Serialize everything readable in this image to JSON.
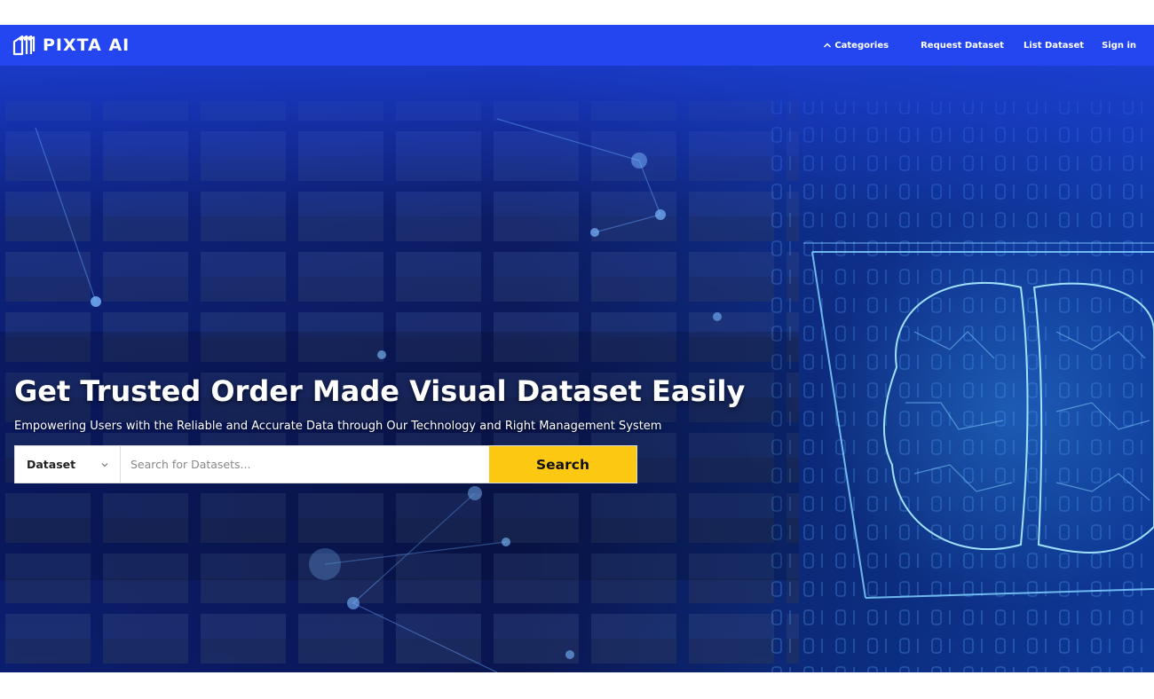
{
  "header": {
    "brand": "PIXTA AI",
    "nav": {
      "categories": "Categories",
      "request_dataset": "Request Dataset",
      "list_dataset": "List Dataset",
      "sign_in": "Sign in"
    },
    "colors": {
      "bar": "#2446f0"
    }
  },
  "hero": {
    "title": "Get Trusted Order Made Visual Dataset Easily",
    "subtitle": "Empowering Users with the Reliable and Accurate Data through Our Technology and Right Management System",
    "search": {
      "category_selected": "Dataset",
      "placeholder": "Search for Datasets...",
      "button_label": "Search"
    },
    "colors": {
      "search_button": "#fcc812"
    }
  },
  "icons": {
    "logo": "pixta-logo-icon",
    "categories_chevron": "chevron-up-icon",
    "select_chevron": "chevron-down-icon"
  }
}
